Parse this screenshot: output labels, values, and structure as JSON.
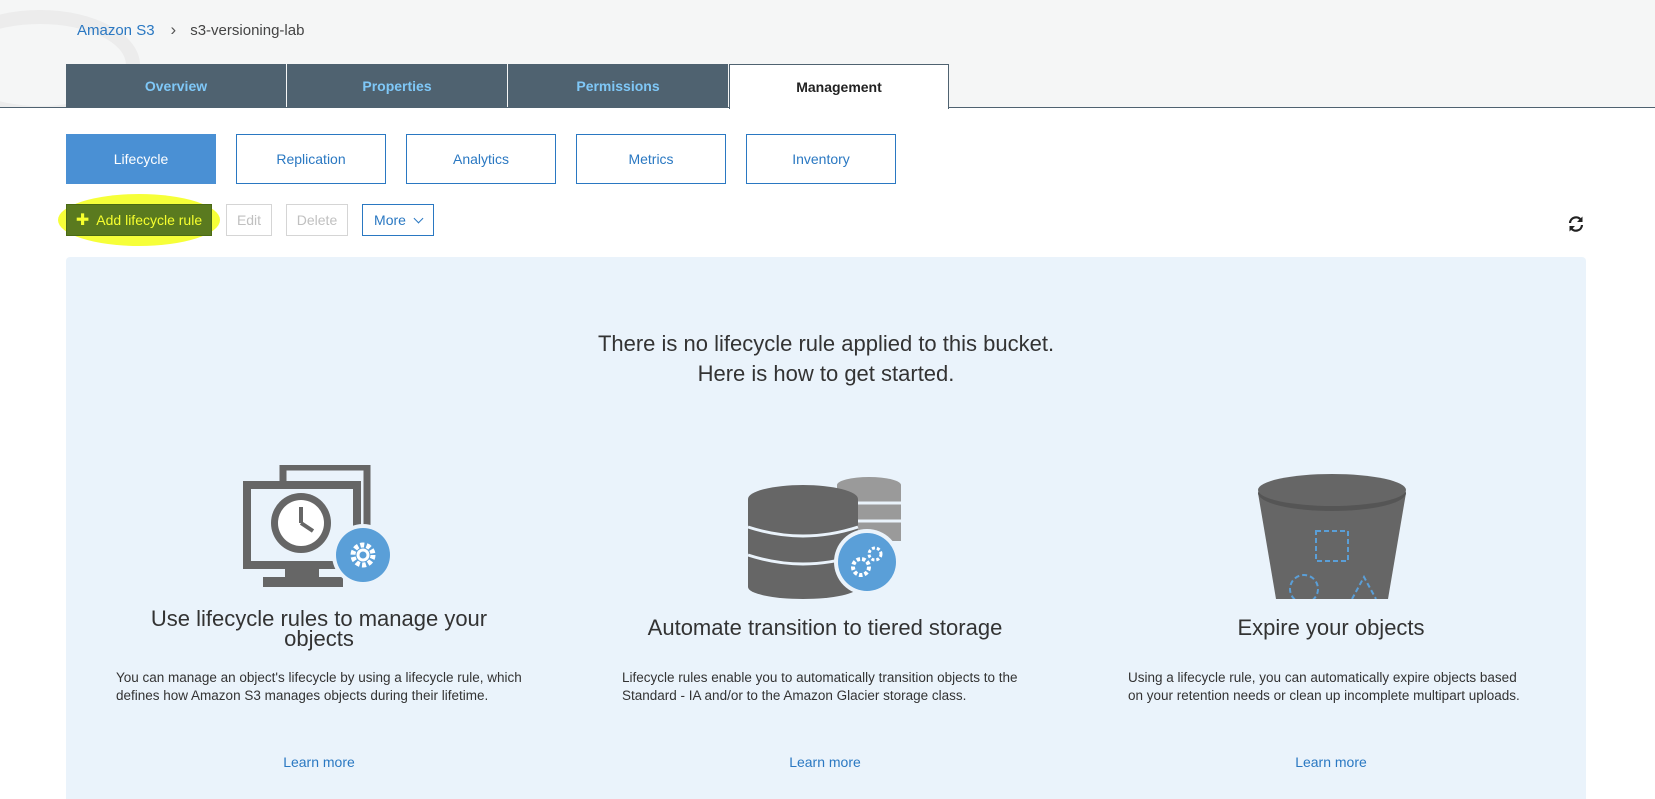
{
  "breadcrumb": {
    "root": "Amazon S3",
    "current": "s3-versioning-lab"
  },
  "main_tabs": [
    {
      "label": "Overview"
    },
    {
      "label": "Properties"
    },
    {
      "label": "Permissions"
    },
    {
      "label": "Management"
    }
  ],
  "sub_tabs": [
    {
      "label": "Lifecycle"
    },
    {
      "label": "Replication"
    },
    {
      "label": "Analytics"
    },
    {
      "label": "Metrics"
    },
    {
      "label": "Inventory"
    }
  ],
  "actions": {
    "add_label": "Add lifecycle rule",
    "edit_label": "Edit",
    "delete_label": "Delete",
    "more_label": "More"
  },
  "empty": {
    "line1": "There is no lifecycle rule applied to this bucket.",
    "line2": "Here is how to get started."
  },
  "columns": [
    {
      "title": "Use lifecycle rules to manage your objects",
      "desc": "You can manage an object's lifecycle by using a lifecycle rule, which defines how Amazon S3 manages objects during their lifetime.",
      "link": "Learn more",
      "icon": "monitor-clock-gear-icon"
    },
    {
      "title": "Automate transition to tiered storage",
      "desc": "Lifecycle rules enable you to automatically transition objects to the Standard - IA and/or to the Amazon Glacier storage class.",
      "link": "Learn more",
      "icon": "database-gears-icon"
    },
    {
      "title": "Expire your objects",
      "desc": "Using a lifecycle rule, you can automatically expire objects based on your retention needs or clean up incomplete multipart uploads.",
      "link": "Learn more",
      "icon": "bucket-icon"
    }
  ],
  "colors": {
    "tab_dark": "#4f6270",
    "tab_text": "#7fc8f8",
    "link_blue": "#2a78c2",
    "active_subtab": "#4a90d4",
    "panel_bg": "#eaf3fb",
    "highlight": "#f6ff2e",
    "icon_gray": "#666666",
    "icon_blue": "#5a9fd8"
  }
}
